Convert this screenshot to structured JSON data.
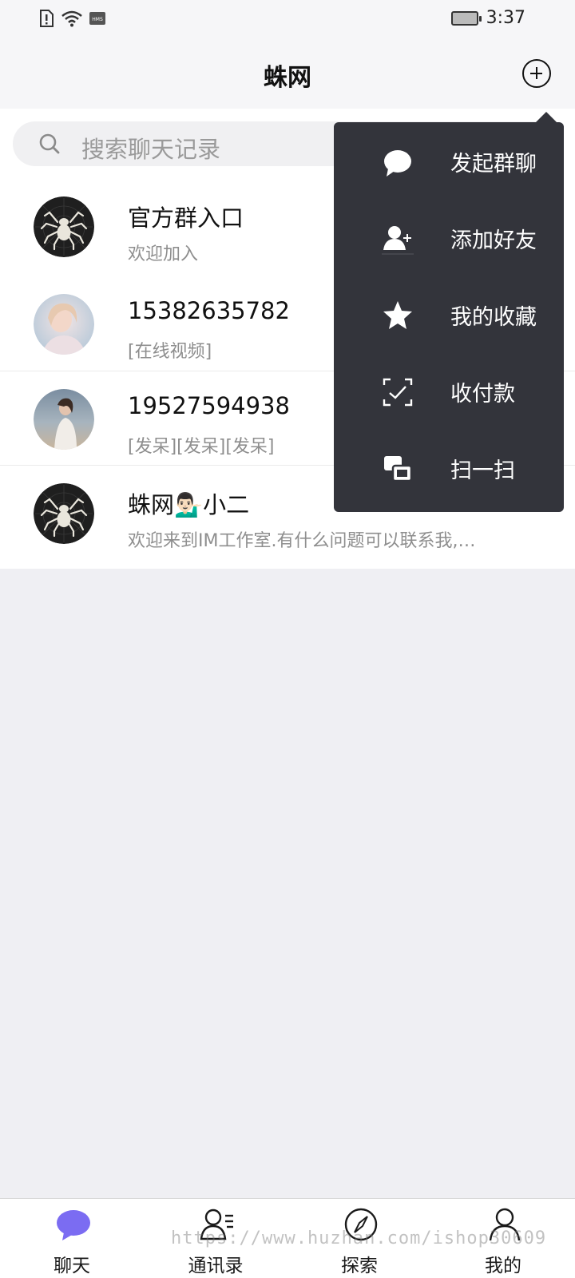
{
  "status_bar": {
    "time": "3:37"
  },
  "header": {
    "title": "蛛网"
  },
  "search": {
    "placeholder": "搜索聊天记录"
  },
  "chats": [
    {
      "name": "官方群入口",
      "preview": "欢迎加入",
      "avatar": "spider-logo"
    },
    {
      "name": "15382635782",
      "preview": "[在线视频]",
      "avatar": "user-photo"
    },
    {
      "name": "19527594938",
      "preview": "[发呆][发呆][发呆]",
      "avatar": "user-photo"
    },
    {
      "name": "蛛网💁🏻‍♂️小二",
      "preview": "欢迎来到IM工作室.有什么问题可以联系我,…",
      "avatar": "spider-logo"
    }
  ],
  "popup_menu": {
    "items": [
      {
        "label": "发起群聊",
        "icon": "chat-bubble-icon"
      },
      {
        "label": "添加好友",
        "icon": "add-friend-icon"
      },
      {
        "label": "我的收藏",
        "icon": "star-icon"
      },
      {
        "label": "收付款",
        "icon": "payment-icon"
      },
      {
        "label": "扫一扫",
        "icon": "scan-icon"
      }
    ]
  },
  "bottom_nav": {
    "items": [
      {
        "label": "聊天",
        "icon": "chat-bubble-icon",
        "active": true
      },
      {
        "label": "通讯录",
        "icon": "contacts-icon",
        "active": false
      },
      {
        "label": "探索",
        "icon": "compass-icon",
        "active": false
      },
      {
        "label": "我的",
        "icon": "person-icon",
        "active": false
      }
    ]
  },
  "watermark": "https://www.huzhan.com/ishop30609",
  "colors": {
    "accent": "#7b6cf2",
    "menu_bg": "#33343b",
    "background": "#efeff3"
  }
}
